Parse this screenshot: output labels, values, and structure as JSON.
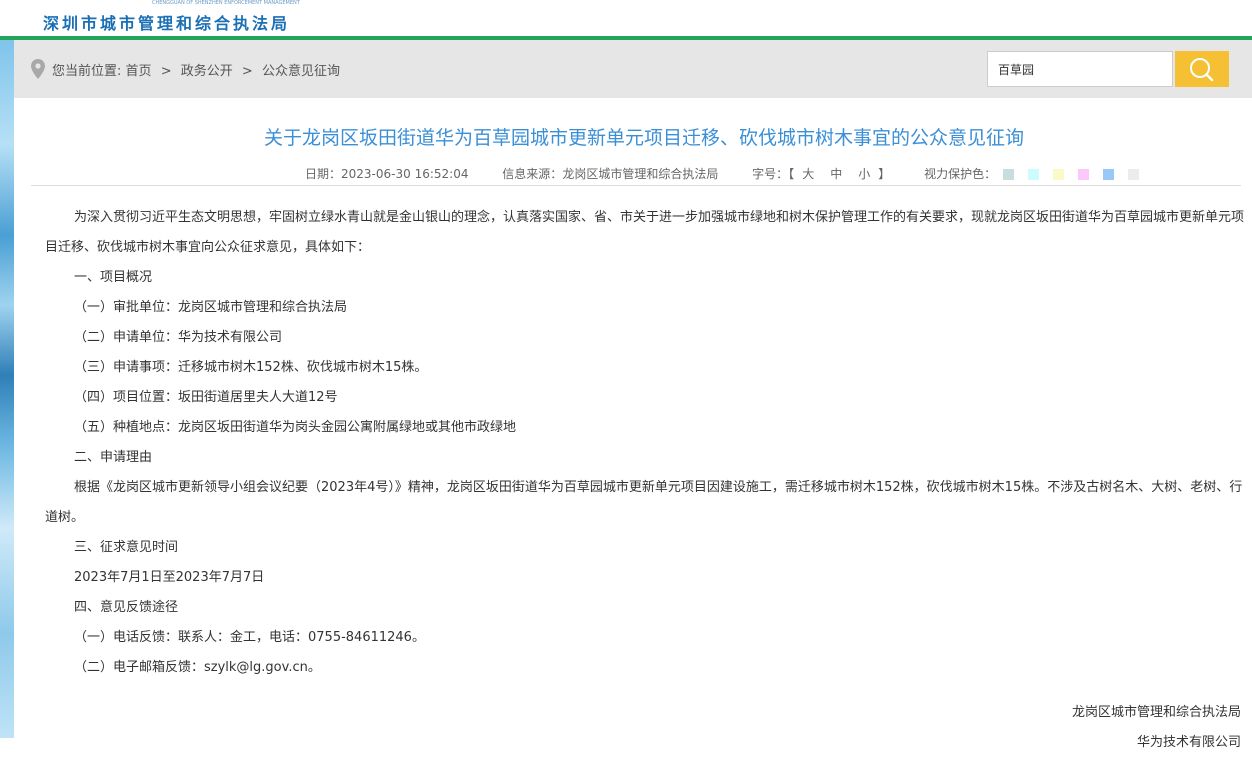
{
  "header": {
    "logo_text": "深圳市城市管理和综合执法局",
    "logo_small": "CHENGGUAN OF SHENZHEN ENFORCEMENT MANAGEMENT"
  },
  "breadcrumb": {
    "prefix": "您当前位置:",
    "items": [
      "首页",
      "政务公开",
      "公众意见征询"
    ],
    "separator": ">"
  },
  "search": {
    "value": "百草园",
    "button_icon": "search-icon"
  },
  "article": {
    "title": "关于龙岗区坂田街道华为百草园城市更新单元项目迁移、砍伐城市树木事宜的公众意见征询",
    "date_label": "日期：",
    "date": "2023-06-30 16:52:04",
    "source_label": "信息来源：",
    "source": "龙岗区城市管理和综合执法局",
    "font_label": "字号：",
    "font_open": "【",
    "font_sizes": [
      "大",
      "中",
      "小"
    ],
    "font_close": "】",
    "eye_label": "视力保护色：",
    "eye_colors": [
      "#c8dede",
      "#cefcfc",
      "#fafac8",
      "#fac8fa",
      "#98c8f8",
      "#ececec"
    ],
    "paragraphs": [
      "为深入贯彻习近平生态文明思想，牢固树立绿水青山就是金山银山的理念，认真落实国家、省、市关于进一步加强城市绿地和树木保护管理工作的有关要求，现就龙岗区坂田街道华为百草园城市更新单元项目迁移、砍伐城市树木事宜向公众征求意见，具体如下：",
      "一、项目概况",
      "（一）审批单位：龙岗区城市管理和综合执法局",
      "（二）申请单位：华为技术有限公司",
      "（三）申请事项：迁移城市树木152株、砍伐城市树木15株。",
      "（四）项目位置：坂田街道居里夫人大道12号",
      "（五）种植地点：龙岗区坂田街道华为岗头金园公寓附属绿地或其他市政绿地",
      "二、申请理由",
      "根据《龙岗区城市更新领导小组会议纪要（2023年4号）》精神，龙岗区坂田街道华为百草园城市更新单元项目因建设施工，需迁移城市树木152株，砍伐城市树木15株。不涉及古树名木、大树、老树、行道树。",
      "三、征求意见时间",
      "2023年7月1日至2023年7月7日",
      "四、意见反馈途径",
      "（一）电话反馈：联系人：金工，电话：0755-84611246。",
      "（二）电子邮箱反馈：szylk@lg.gov.cn。"
    ],
    "signature": [
      "龙岗区城市管理和综合执法局",
      "华为技术有限公司"
    ]
  },
  "colors": {
    "accent": "#3b8fd6",
    "green_bar": "#23a45c",
    "search_button": "#f5c033",
    "logo": "#1a6fb5"
  }
}
